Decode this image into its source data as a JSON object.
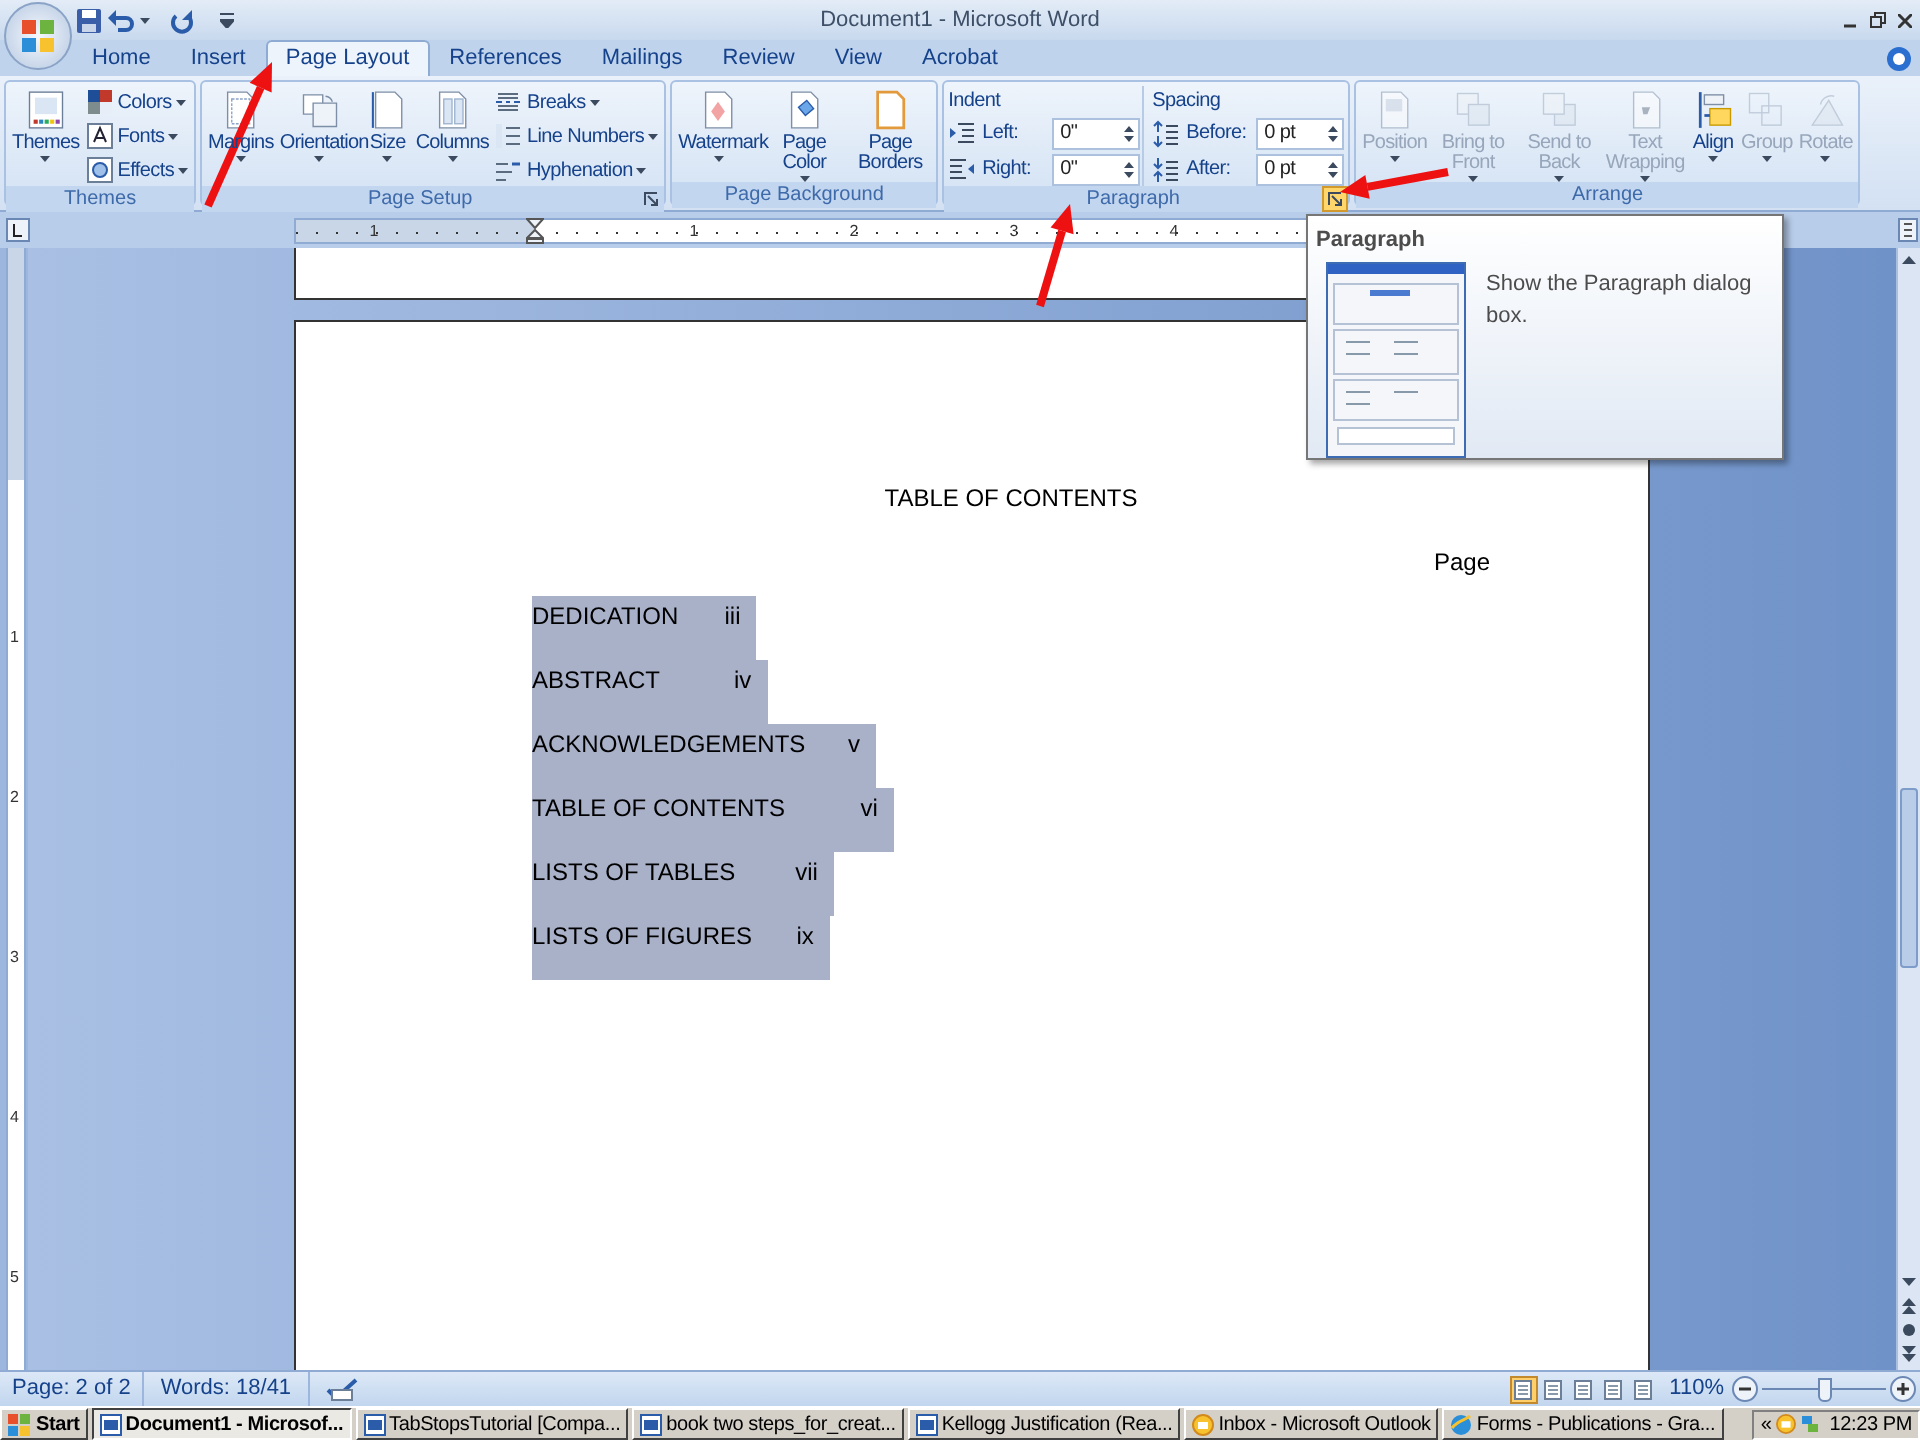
{
  "title_bar": {
    "title": "Document1 - Microsoft Word"
  },
  "tabs": [
    {
      "label": "Home",
      "selected": false
    },
    {
      "label": "Insert",
      "selected": false
    },
    {
      "label": "Page Layout",
      "selected": true
    },
    {
      "label": "References",
      "selected": false
    },
    {
      "label": "Mailings",
      "selected": false
    },
    {
      "label": "Review",
      "selected": false
    },
    {
      "label": "View",
      "selected": false
    },
    {
      "label": "Acrobat",
      "selected": false
    }
  ],
  "ribbon": {
    "groups": [
      {
        "label": "Themes",
        "controls": [
          {
            "kind": "large",
            "label": "Themes",
            "dropdown": true,
            "disabled": false
          },
          {
            "kind": "stack",
            "items": [
              {
                "label": "Colors",
                "dropdown": true
              },
              {
                "label": "Fonts",
                "dropdown": true
              },
              {
                "label": "Effects",
                "dropdown": true
              }
            ]
          }
        ]
      },
      {
        "label": "Page Setup",
        "launcher": {
          "highlighted": false
        },
        "controls": [
          {
            "kind": "large",
            "label": "Margins",
            "dropdown": true,
            "disabled": false
          },
          {
            "kind": "large",
            "label": "Orientation",
            "dropdown": true,
            "disabled": false
          },
          {
            "kind": "large",
            "label": "Size",
            "dropdown": true,
            "disabled": false
          },
          {
            "kind": "large",
            "label": "Columns",
            "dropdown": true,
            "disabled": false
          },
          {
            "kind": "stack",
            "items": [
              {
                "label": "Breaks",
                "dropdown": true
              },
              {
                "label": "Line Numbers",
                "dropdown": true
              },
              {
                "label": "Hyphenation",
                "dropdown": true
              }
            ]
          }
        ]
      },
      {
        "label": "Page Background",
        "controls": [
          {
            "kind": "large",
            "label": "Watermark",
            "dropdown": true,
            "disabled": false
          },
          {
            "kind": "large",
            "label": "Page Color",
            "dropdown": true,
            "disabled": false
          },
          {
            "kind": "large",
            "label": "Page Borders",
            "dropdown": false,
            "disabled": false
          }
        ]
      },
      {
        "label": "Paragraph",
        "launcher": {
          "highlighted": true
        },
        "controls": [
          {
            "kind": "spinners",
            "heading": "Indent",
            "fields": [
              {
                "label": "Left:",
                "value": "0\""
              },
              {
                "label": "Right:",
                "value": "0\""
              }
            ]
          },
          {
            "kind": "spinners",
            "heading": "Spacing",
            "fields": [
              {
                "label": "Before:",
                "value": "0 pt"
              },
              {
                "label": "After:",
                "value": "0 pt"
              }
            ]
          }
        ]
      },
      {
        "label": "Arrange",
        "controls": [
          {
            "kind": "large",
            "label": "Position",
            "dropdown": true,
            "disabled": true
          },
          {
            "kind": "large",
            "label": "Bring to Front",
            "dropdown": true,
            "disabled": true
          },
          {
            "kind": "large",
            "label": "Send to Back",
            "dropdown": true,
            "disabled": true
          },
          {
            "kind": "large",
            "label": "Text Wrapping",
            "dropdown": true,
            "disabled": true
          },
          {
            "kind": "large",
            "label": "Align",
            "dropdown": true,
            "disabled": false
          },
          {
            "kind": "large",
            "label": "Group",
            "dropdown": true,
            "disabled": true
          },
          {
            "kind": "large",
            "label": "Rotate",
            "dropdown": true,
            "disabled": true
          }
        ]
      }
    ]
  },
  "ruler": {
    "h_numbers": [
      "1",
      "1",
      "2",
      "3",
      "4"
    ],
    "v_numbers": [
      "1",
      "2",
      "3",
      "4",
      "5"
    ]
  },
  "tooltip": {
    "title": "Paragraph",
    "description": "Show the Paragraph dialog box."
  },
  "document": {
    "heading": "TABLE OF CONTENTS",
    "page_label": "Page",
    "entries": [
      {
        "title": "DEDICATION",
        "page": "iii",
        "selected": true
      },
      {
        "title": "ABSTRACT",
        "page": "iv",
        "selected": true
      },
      {
        "title": "ACKNOWLEDGEMENTS",
        "page": "v",
        "selected": true
      },
      {
        "title": "TABLE OF CONTENTS",
        "page": "vi",
        "selected": true
      },
      {
        "title": "LISTS OF TABLES",
        "page": "vii",
        "selected": true
      },
      {
        "title": "LISTS OF FIGURES",
        "page": "ix",
        "selected": true
      }
    ]
  },
  "status_bar": {
    "page": "Page: 2 of 2",
    "words": "Words: 18/41",
    "views": [
      {
        "selected": true
      },
      {
        "selected": false
      },
      {
        "selected": false
      },
      {
        "selected": false
      },
      {
        "selected": false
      }
    ],
    "zoom": "110%",
    "zoom_slider": {
      "level": 0.5
    }
  },
  "taskbar": {
    "start": "Start",
    "tasks": [
      {
        "label": "Document1 - Microsof...",
        "kind": "word",
        "selected": true
      },
      {
        "label": "TabStopsTutorial [Compa...",
        "kind": "word",
        "selected": false
      },
      {
        "label": "book two steps_for_creat...",
        "kind": "word",
        "selected": false
      },
      {
        "label": "Kellogg Justification (Rea...",
        "kind": "word",
        "selected": false
      },
      {
        "label": "Inbox - Microsoft Outlook",
        "kind": "outlook",
        "selected": false
      },
      {
        "label": "Forms - Publications - Gra...",
        "kind": "browser",
        "selected": false
      }
    ],
    "chevron": "«",
    "clock": "12:23 PM"
  }
}
